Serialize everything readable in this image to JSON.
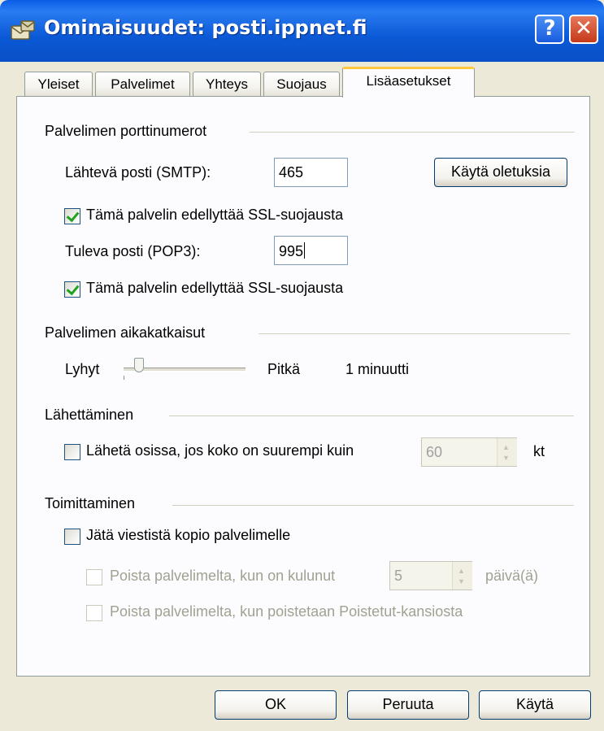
{
  "window": {
    "title": "Ominaisuudet: posti.ippnet.fi",
    "help_label": "?",
    "close_label": "✕"
  },
  "tabs": [
    {
      "label": "Yleiset"
    },
    {
      "label": "Palvelimet"
    },
    {
      "label": "Yhteys"
    },
    {
      "label": "Suojaus"
    },
    {
      "label": "Lisäasetukset",
      "active": true
    }
  ],
  "ports": {
    "group_label": "Palvelimen porttinumerot",
    "smtp_label": "Lähtevä posti (SMTP):",
    "smtp_value": "465",
    "defaults_button": "Käytä oletuksia",
    "smtp_ssl_label": "Tämä palvelin edellyttää SSL-suojausta",
    "smtp_ssl_checked": true,
    "pop3_label": "Tuleva posti (POP3):",
    "pop3_value": "995",
    "pop3_ssl_label": "Tämä palvelin edellyttää SSL-suojausta",
    "pop3_ssl_checked": true
  },
  "timeouts": {
    "group_label": "Palvelimen aikakatkaisut",
    "short_label": "Lyhyt",
    "long_label": "Pitkä",
    "value_text": "1 minuutti",
    "slider_level": 0.1
  },
  "sending": {
    "group_label": "Lähettäminen",
    "split_label": "Lähetä osissa, jos koko on suurempi kuin",
    "split_checked": false,
    "split_value": "60",
    "unit": "kt"
  },
  "delivery": {
    "group_label": "Toimittaminen",
    "leave_copy_label": "Jätä viestistä kopio palvelimelle",
    "leave_copy_checked": false,
    "remove_after_label": "Poista palvelimelta, kun on kulunut",
    "remove_after_value": "5",
    "days_unit": "päivä(ä)",
    "remove_deleted_label": "Poista palvelimelta, kun poistetaan Poistetut-kansiosta"
  },
  "footer": {
    "ok": "OK",
    "cancel": "Peruuta",
    "apply": "Käytä"
  },
  "colors": {
    "titlebar": "#0a5de6",
    "close_button": "#c33a1b",
    "tab_highlight": "#ffc83d",
    "check": "#21a121"
  }
}
